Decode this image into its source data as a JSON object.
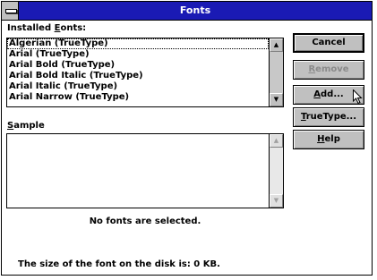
{
  "window": {
    "title": "Fonts"
  },
  "installed_fonts": {
    "label_mnemonic": "E",
    "label_prefix": "Installed ",
    "label_suffix": "onts:",
    "items": [
      "Algerian (TrueType)",
      "Arial (TrueType)",
      "Arial Bold (TrueType)",
      "Arial Bold Italic (TrueType)",
      "Arial Italic (TrueType)",
      "Arial Narrow (TrueType)"
    ],
    "selected_index": 0
  },
  "sample": {
    "label_mnemonic": "S",
    "label_suffix": "ample",
    "message": "No fonts are selected."
  },
  "buttons": {
    "cancel": "Cancel",
    "remove_mnemonic": "R",
    "remove_suffix": "emove",
    "add_mnemonic": "A",
    "add_suffix": "dd...",
    "truetype_mnemonic": "T",
    "truetype_suffix": "rueType...",
    "help_mnemonic": "H",
    "help_suffix": "elp"
  },
  "status": {
    "disk_size_text": "The size of the font on the disk is:  0 KB."
  },
  "icons": {
    "system_menu": "system-menu-icon",
    "scroll_up": "arrow-up-icon",
    "scroll_down": "arrow-down-icon",
    "cursor": "mouse-pointer-icon"
  }
}
